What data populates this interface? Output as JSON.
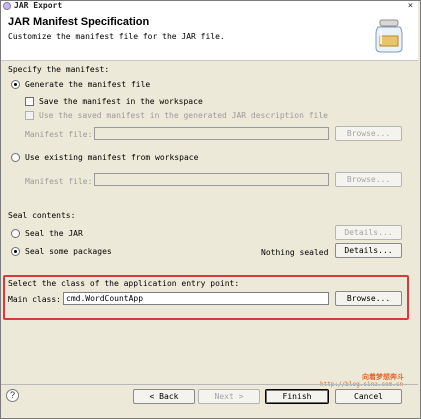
{
  "window": {
    "title": "JAR Export",
    "close_glyph": "×"
  },
  "banner": {
    "title": "JAR Manifest Specification",
    "description": "Customize the manifest file for the JAR file.",
    "icon": "jar-icon"
  },
  "manifest": {
    "heading": "Specify the manifest:",
    "generate_label": "Generate the manifest file",
    "save_label": "Save the manifest in the workspace",
    "reuse_label": "Use the saved manifest in the generated JAR description file",
    "manifest_file_label": "Manifest file:",
    "browse1_label": "Browse...",
    "use_existing_label": "Use existing manifest from workspace",
    "manifest_file2_label": "Manifest file:",
    "browse2_label": "Browse..."
  },
  "seal": {
    "heading": "Seal contents:",
    "seal_jar_label": "Seal the JAR",
    "details1_label": "Details...",
    "seal_some_label": "Seal some packages",
    "nothing_sealed": "Nothing sealed",
    "details2_label": "Details..."
  },
  "entry": {
    "heading": "Select the class of the application entry point:",
    "main_class_label": "Main class:",
    "main_class_value": "cmd.WordCountApp",
    "browse_label": "Browse..."
  },
  "watermark": {
    "line1": "向着梦想奔斗",
    "line2": "http://blog.sina.com.cn"
  },
  "footer": {
    "help_glyph": "?",
    "back_label": "< Back",
    "next_label": "Next >",
    "finish_label": "Finish",
    "cancel_label": "Cancel"
  }
}
